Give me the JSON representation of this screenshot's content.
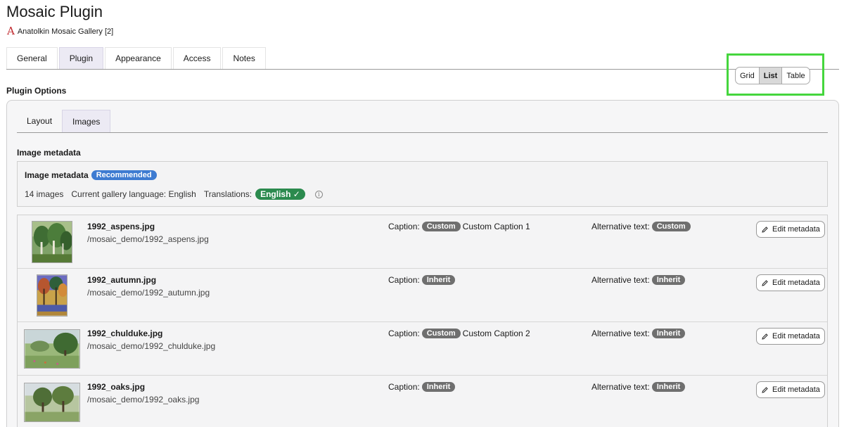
{
  "page": {
    "title": "Mosaic Plugin",
    "gallery_name": "Anatolkin Mosaic Gallery [2]",
    "logo_glyph": "A"
  },
  "main_tabs": [
    {
      "label": "General",
      "active": false
    },
    {
      "label": "Plugin",
      "active": true
    },
    {
      "label": "Appearance",
      "active": false
    },
    {
      "label": "Access",
      "active": false
    },
    {
      "label": "Notes",
      "active": false
    }
  ],
  "plugin_options": {
    "title": "Plugin Options",
    "sub_tabs": [
      {
        "label": "Layout",
        "active": false
      },
      {
        "label": "Images",
        "active": true
      }
    ],
    "section_heading": "Image metadata",
    "metadata_box": {
      "title": "Image metadata",
      "recommended_badge": "Recommended",
      "image_count": "14 images",
      "language_text": "Current gallery language: English",
      "translations_label": "Translations:",
      "translation_badge": "English ✓",
      "info_icon": "i"
    },
    "view_toggle": {
      "options": [
        "Grid",
        "List",
        "Table"
      ],
      "selected": "List"
    }
  },
  "images": [
    {
      "filename": "1992_aspens.jpg",
      "path": "/mosaic_demo/1992_aspens.jpg",
      "caption_label": "Caption:",
      "caption_badge": "Custom",
      "caption_text": "Custom Caption 1",
      "alt_label": "Alternative text:",
      "alt_badge": "Custom",
      "edit_label": "Edit metadata"
    },
    {
      "filename": "1992_autumn.jpg",
      "path": "/mosaic_demo/1992_autumn.jpg",
      "caption_label": "Caption:",
      "caption_badge": "Inherit",
      "caption_text": "",
      "alt_label": "Alternative text:",
      "alt_badge": "Inherit",
      "edit_label": "Edit metadata"
    },
    {
      "filename": "1992_chulduke.jpg",
      "path": "/mosaic_demo/1992_chulduke.jpg",
      "caption_label": "Caption:",
      "caption_badge": "Custom",
      "caption_text": "Custom Caption 2",
      "alt_label": "Alternative text:",
      "alt_badge": "Inherit",
      "edit_label": "Edit metadata"
    },
    {
      "filename": "1992_oaks.jpg",
      "path": "/mosaic_demo/1992_oaks.jpg",
      "caption_label": "Caption:",
      "caption_badge": "Inherit",
      "caption_text": "",
      "alt_label": "Alternative text:",
      "alt_badge": "Inherit",
      "edit_label": "Edit metadata"
    }
  ],
  "colors": {
    "accent_blue": "#3d7bd1",
    "success_green": "#2b8a4e",
    "badge_gray": "#6f6f6f",
    "highlight_green": "#45d63d",
    "logo_red": "#c0282d"
  }
}
